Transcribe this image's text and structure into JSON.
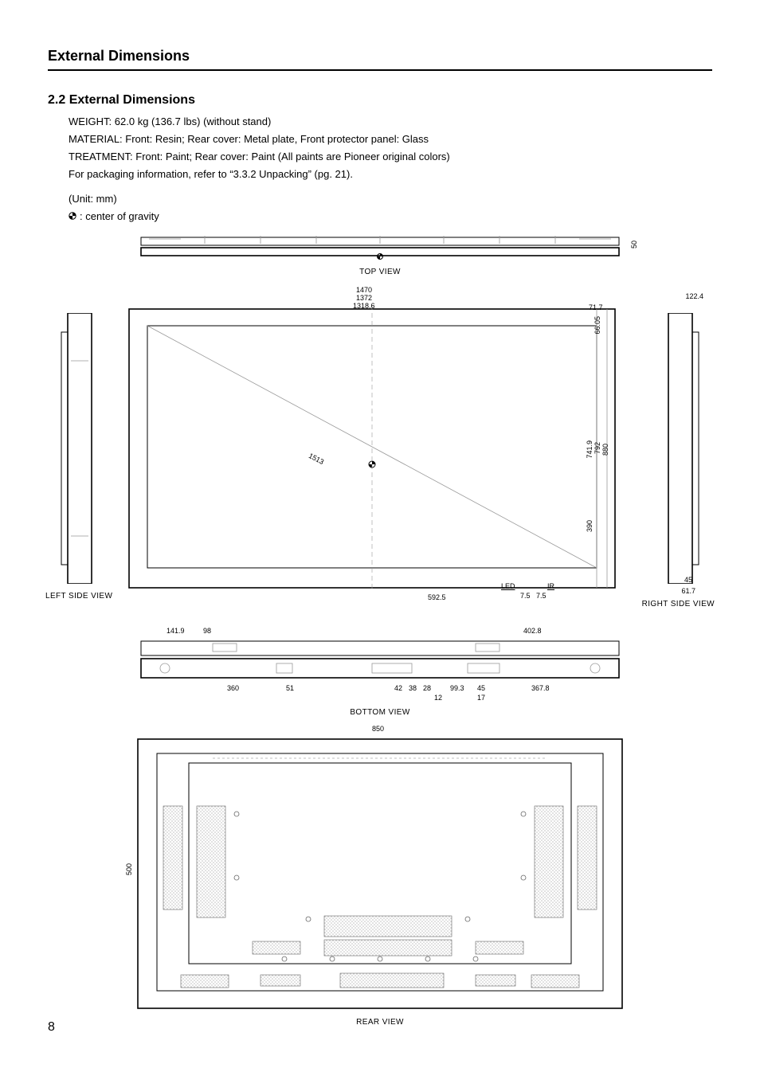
{
  "header": {
    "title": "External Dimensions"
  },
  "section": {
    "number_title": "2.2 External Dimensions",
    "weight": "WEIGHT: 62.0 kg (136.7 lbs) (without stand)",
    "material": "MATERIAL: Front: Resin; Rear cover: Metal plate, Front protector panel: Glass",
    "treatment": "TREATMENT: Front: Paint; Rear cover: Paint (All paints are Pioneer original colors)",
    "packaging_ref": "For packaging information, refer to “3.3.2 Unpacking” (pg. 21).",
    "unit": "(Unit: mm)",
    "cog_text": ": center of gravity"
  },
  "views": {
    "top": "TOP VIEW",
    "left": "LEFT SIDE VIEW",
    "right": "RIGHT SIDE VIEW",
    "bottom": "BOTTOM VIEW",
    "rear": "REAR VIEW"
  },
  "dimensions": {
    "top_depth": "50",
    "front_widths": {
      "w1": "1470",
      "w2": "1372",
      "w3": "1318.6"
    },
    "front_right": {
      "a": "71.7",
      "b": "66.05"
    },
    "right_side_top": "122.4",
    "right_side_bottom": {
      "a": "45",
      "b": "61.7"
    },
    "front_heights": {
      "h1": "741.9",
      "h2": "792",
      "h3": "880"
    },
    "front_diag": "1513",
    "front_lower_h": "390",
    "front_bottom_center": "592.5",
    "led": "LED",
    "ir": "IR",
    "led_ir_gap": {
      "a": "7.5",
      "b": "7.5"
    },
    "bottom_left": {
      "a": "141.9",
      "b": "98"
    },
    "bottom_row": {
      "a": "360",
      "b": "51",
      "c": "42",
      "d": "38",
      "e": "28",
      "f": "99.3",
      "g": "45",
      "h": "367.8"
    },
    "bottom_sub": {
      "a": "12",
      "b": "17"
    },
    "bottom_right": "402.8",
    "rear_w": "850",
    "rear_h": "500"
  },
  "page_number": "8"
}
